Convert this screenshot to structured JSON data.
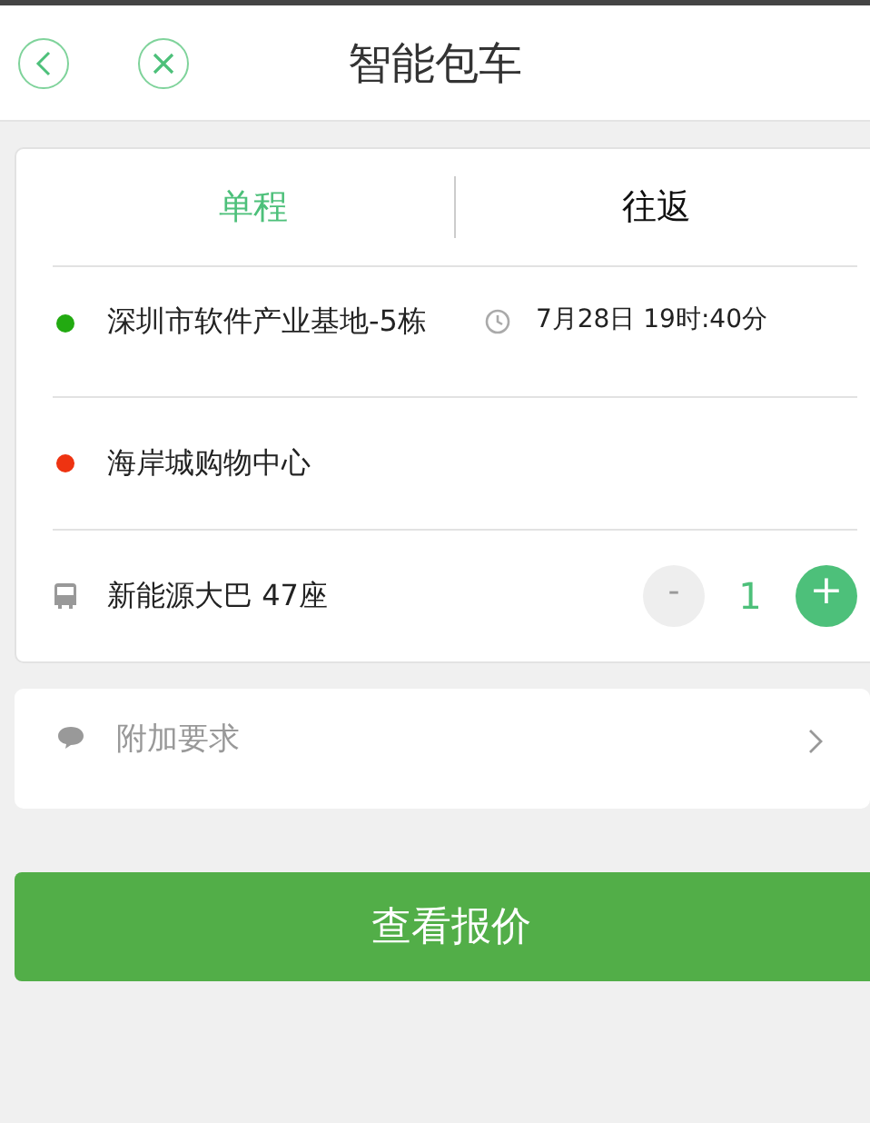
{
  "header": {
    "title": "智能包车"
  },
  "tabs": [
    {
      "label": "单程",
      "selected": true
    },
    {
      "label": "往返",
      "selected": false
    }
  ],
  "route": [
    {
      "place": "深圳市软件产业基地-5栋",
      "color": "#22aa11",
      "time": "7月28日 19时:40分"
    },
    {
      "place": "海岸城购物中心",
      "color": "#ee3311"
    }
  ],
  "vehicle": {
    "name": "新能源大巴 47座",
    "minus": "-",
    "count": "1",
    "plus": "+",
    "minus_disabled": true
  },
  "extra": {
    "label": "附加要求"
  },
  "submit": "查看报价"
}
